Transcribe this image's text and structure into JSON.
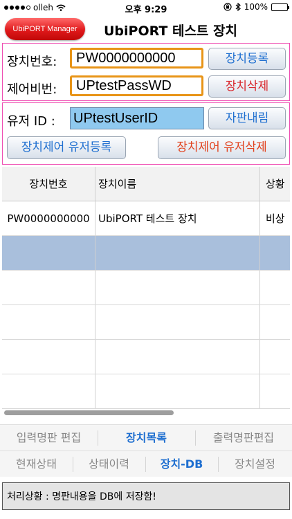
{
  "status_bar": {
    "carrier": "olleh",
    "time": "오후 9:29",
    "battery": "100%",
    "battery_level": 1.0
  },
  "header": {
    "manager_button": "UbiPORT Manager",
    "title": "UbiPORT 테스트 장치"
  },
  "device_panel": {
    "device_no_label": "장치번호:",
    "device_no_value": "PW0000000000",
    "register_button": "장치등록",
    "control_pw_label": "제어비번:",
    "control_pw_value": "UPtestPassWD",
    "delete_button": "장치삭제"
  },
  "user_panel": {
    "user_id_label": "유저 ID :",
    "user_id_value": "UPtestUserID",
    "vending_button": "자판내림",
    "register_user_button": "장치제어 유저등록",
    "delete_user_button": "장치제어 유저삭제"
  },
  "table": {
    "columns": [
      "장치번호",
      "장치이름",
      "상황"
    ],
    "rows": [
      [
        "PW0000000000",
        "UbiPORT 테스트 장치",
        "비상"
      ],
      [
        "",
        "",
        ""
      ],
      [
        "",
        "",
        ""
      ],
      [
        "",
        "",
        ""
      ],
      [
        "",
        "",
        ""
      ],
      [
        "",
        "",
        ""
      ]
    ],
    "selected_row": 1
  },
  "tabs_row1": [
    "입력명판 편집",
    "장치목록",
    "출력명판편집"
  ],
  "tabs_row2": [
    "현재상태",
    "상태이력",
    "장치-DB",
    "장치설정"
  ],
  "status_message": "처리상황 : 명판내용을 DB에 저장함!",
  "colors": {
    "panel_border": "#ef4fb3",
    "input_border": "#e89417",
    "user_input_bg": "#8fc9ef",
    "active_tab": "#1f6fd0",
    "selected_row": "#a9bfdc"
  }
}
